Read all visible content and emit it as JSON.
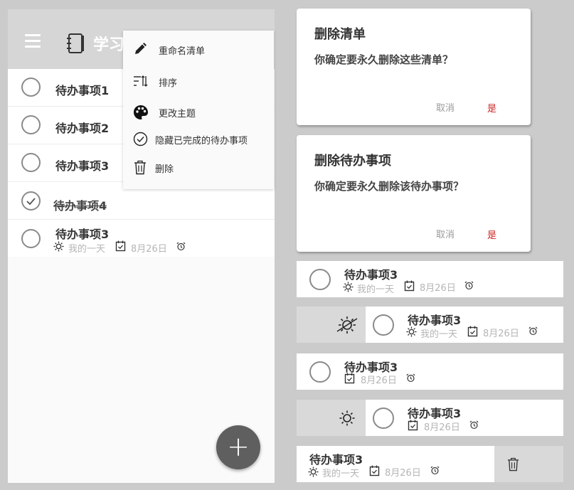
{
  "app": {
    "list_title": "学习"
  },
  "todos": [
    {
      "title": "待办事项1",
      "done": false
    },
    {
      "title": "待办事项2",
      "done": false
    },
    {
      "title": "待办事项3",
      "done": false
    },
    {
      "title": "待办事项4",
      "done": true
    },
    {
      "title": "待办事项3",
      "done": false,
      "my_day": "我的一天",
      "due": "8月26日"
    }
  ],
  "menu": {
    "items": [
      {
        "label": "重命名清单",
        "icon": "pencil-icon"
      },
      {
        "label": "排序",
        "icon": "sort-icon"
      },
      {
        "label": "更改主题",
        "icon": "palette-icon"
      },
      {
        "label": "隐藏已完成的待办事项",
        "icon": "check-circle-icon"
      },
      {
        "label": "删除",
        "icon": "trash-icon"
      }
    ]
  },
  "fab": {
    "label": "+"
  },
  "dialogs": [
    {
      "title": "删除清单",
      "message": "你确定要永久删除这些清单？",
      "cancel": "取消",
      "confirm": "是"
    },
    {
      "title": "删除待办事项",
      "message": "你确定要永久删除该待办事项？",
      "cancel": "取消",
      "confirm": "是"
    }
  ],
  "item_states": [
    {
      "title": "待办事项3",
      "my_day": "我的一天",
      "due": "8月26日"
    },
    {
      "title": "待办事项3",
      "my_day": "我的一天",
      "due": "8月26日",
      "swipe_action": "remove-from-my-day"
    },
    {
      "title": "待办事项3",
      "due": "8月26日"
    },
    {
      "title": "待办事项3",
      "due": "8月26日",
      "swipe_action": "add-to-my-day"
    },
    {
      "title": "待办事项3",
      "my_day": "我的一天",
      "due": "8月26日",
      "swipe_action": "delete"
    }
  ],
  "colors": {
    "appbar": "#d6d6d6",
    "fab": "#5f5f5f",
    "confirm": "#cc2222",
    "meta_text": "#b5b5b5"
  }
}
